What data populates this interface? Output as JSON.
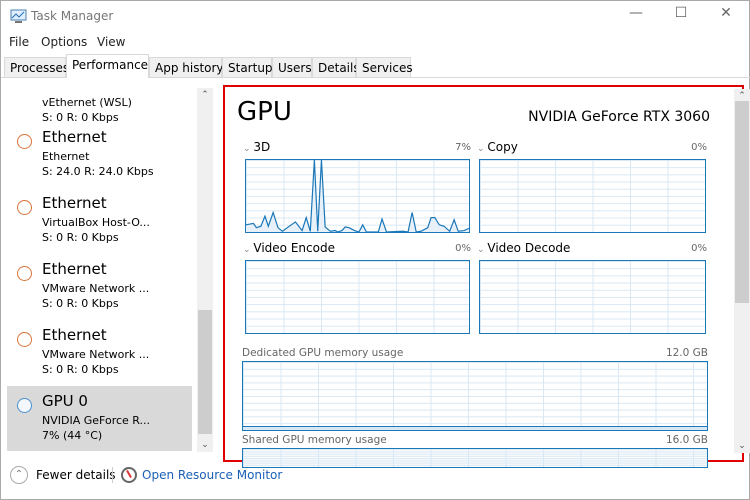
{
  "window": {
    "title": "Task Manager",
    "controls": [
      "minimize",
      "maximize",
      "close"
    ]
  },
  "menu": [
    "File",
    "Options",
    "View"
  ],
  "tabs": [
    "Processes",
    "Performance",
    "App history",
    "Startup",
    "Users",
    "Details",
    "Services"
  ],
  "active_tab": "Performance",
  "sidebar": {
    "partial": {
      "title": "vEthernet (WSL)",
      "stat": "S: 0 R: 0 Kbps"
    },
    "items": [
      {
        "title": "Ethernet",
        "sub": "Ethernet",
        "stat": "S: 24.0 R: 24.0 Kbps",
        "icon": "orange-circle"
      },
      {
        "title": "Ethernet",
        "sub": "VirtualBox Host-O...",
        "stat": "S: 0 R: 0 Kbps",
        "icon": "orange-circle"
      },
      {
        "title": "Ethernet",
        "sub": "VMware Network ...",
        "stat": "S: 0 R: 0 Kbps",
        "icon": "orange-circle"
      },
      {
        "title": "Ethernet",
        "sub": "VMware Network ...",
        "stat": "S: 0 R: 0 Kbps",
        "icon": "orange-circle"
      },
      {
        "title": "GPU 0",
        "sub": "NVIDIA GeForce R...",
        "stat": "7% (44 °C)",
        "icon": "blue-circle",
        "selected": true
      }
    ]
  },
  "main": {
    "heading": "GPU",
    "device": "NVIDIA GeForce RTX 3060",
    "engines": [
      {
        "label": "3D",
        "pct": "7%"
      },
      {
        "label": "Copy",
        "pct": "0%"
      },
      {
        "label": "Video Encode",
        "pct": "0%"
      },
      {
        "label": "Video Decode",
        "pct": "0%"
      }
    ],
    "dedicated": {
      "label": "Dedicated GPU memory usage",
      "max": "12.0 GB"
    },
    "shared": {
      "label": "Shared GPU memory usage",
      "max": "16.0 GB"
    },
    "colors": {
      "graph_line": "#1a77b8",
      "grid": "#d8e8f4",
      "highlight": "#e00000"
    }
  },
  "chart_data": {
    "type": "area",
    "title": "3D",
    "ylim": [
      0,
      100
    ],
    "xlim": [
      0,
      60
    ],
    "points": [
      [
        0,
        10
      ],
      [
        2,
        12
      ],
      [
        2.8,
        6
      ],
      [
        4,
        8
      ],
      [
        5.1,
        22
      ],
      [
        6,
        8
      ],
      [
        7.3,
        27
      ],
      [
        8.6,
        6
      ],
      [
        9.8,
        1
      ],
      [
        11.1,
        6
      ],
      [
        13.3,
        14
      ],
      [
        15.1,
        2
      ],
      [
        16.2,
        20
      ],
      [
        17.3,
        1
      ],
      [
        18.4,
        100
      ],
      [
        19.3,
        1
      ],
      [
        20.3,
        100
      ],
      [
        21.3,
        7
      ],
      [
        22.7,
        1
      ],
      [
        24,
        2
      ],
      [
        24.7,
        0
      ],
      [
        25.8,
        2
      ],
      [
        26.7,
        7
      ],
      [
        27.7,
        6
      ],
      [
        29.2,
        2
      ],
      [
        30.4,
        0
      ],
      [
        31.4,
        10
      ],
      [
        32.4,
        0
      ],
      [
        35.6,
        0
      ],
      [
        36.6,
        18
      ],
      [
        37.8,
        0
      ],
      [
        42.2,
        1
      ],
      [
        43.6,
        0
      ],
      [
        44.7,
        27
      ],
      [
        45.8,
        0
      ],
      [
        47.1,
        1
      ],
      [
        48.9,
        6
      ],
      [
        49.8,
        20
      ],
      [
        50.8,
        20
      ],
      [
        52,
        10
      ],
      [
        53.3,
        8
      ],
      [
        54.8,
        1
      ],
      [
        56,
        17
      ],
      [
        57.1,
        1
      ],
      [
        58.7,
        2
      ],
      [
        60,
        5
      ]
    ]
  },
  "footer": {
    "fewer": "Fewer details",
    "monitor": "Open Resource Monitor"
  }
}
